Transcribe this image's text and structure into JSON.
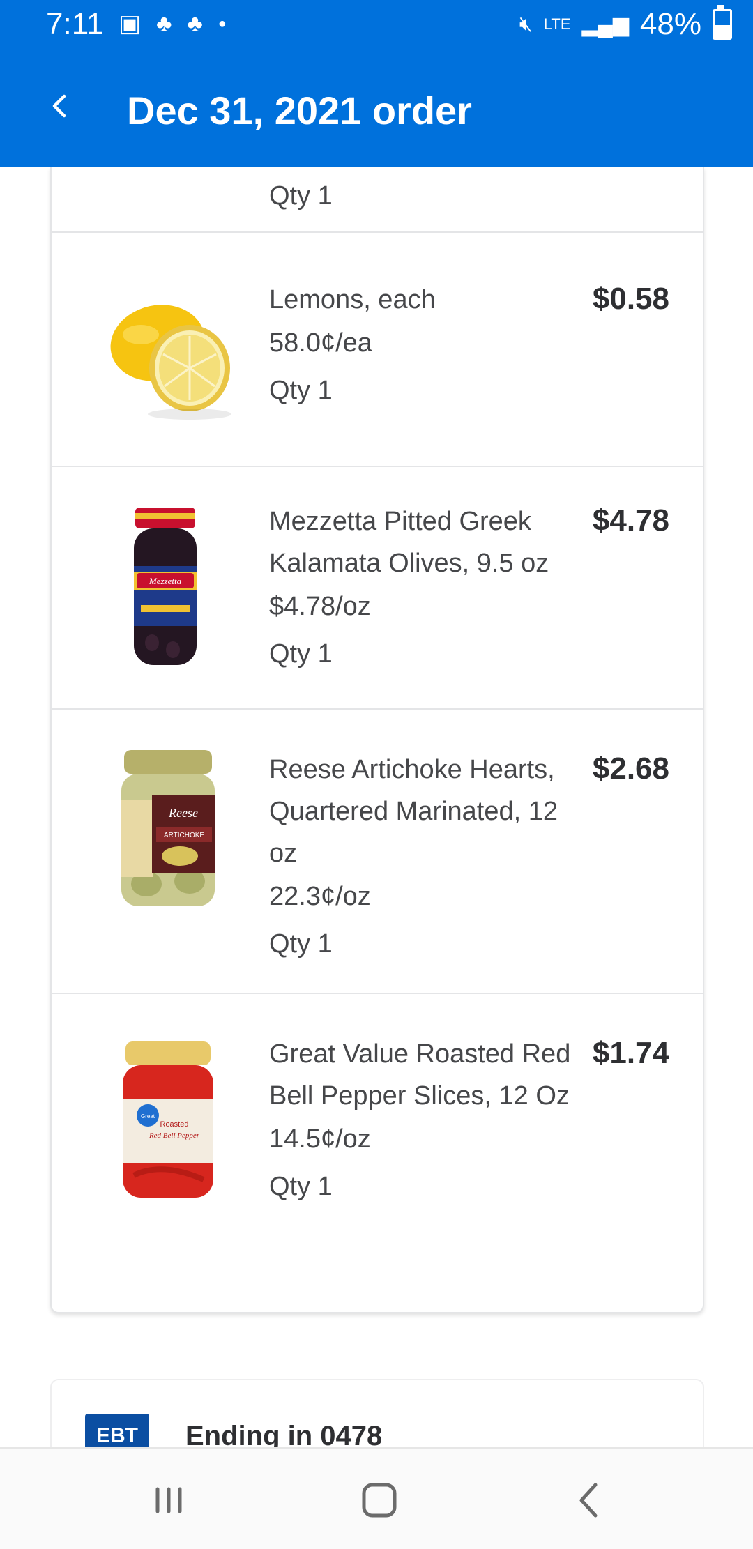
{
  "status_bar": {
    "time": "7:11",
    "battery_percent": "48%",
    "network": "LTE",
    "battery_level": 0.48,
    "icons": [
      "image-icon",
      "plant-icon",
      "plant-icon",
      "dot-icon",
      "mute-icon",
      "lte-icon",
      "signal-icon",
      "battery-icon"
    ]
  },
  "header": {
    "title": "Dec 31, 2021 order",
    "back_icon": "chevron-left-icon"
  },
  "partial_item": {
    "qty": "Qty 1"
  },
  "items": [
    {
      "name": "Lemons, each",
      "unit_price": "58.0¢/ea",
      "qty": "Qty 1",
      "price": "$0.58",
      "image": "lemon"
    },
    {
      "name": "Mezzetta Pitted Greek Kalamata Olives, 9.5 oz",
      "unit_price": "$4.78/oz",
      "qty": "Qty 1",
      "price": "$4.78",
      "image": "olive-jar"
    },
    {
      "name": "Reese Artichoke Hearts, Quartered Marinated, 12 oz",
      "unit_price": "22.3¢/oz",
      "qty": "Qty 1",
      "price": "$2.68",
      "image": "artichoke-jar"
    },
    {
      "name": "Great Value Roasted Red Bell Pepper Slices, 12 Oz",
      "unit_price": "14.5¢/oz",
      "qty": "Qty 1",
      "price": "$1.74",
      "image": "pepper-jar"
    }
  ],
  "payment": {
    "logo_text": "EBT",
    "ending": "Ending in 0478"
  },
  "colors": {
    "brand_blue": "#0071dc",
    "divider": "#e4e5e7",
    "text": "#46474a"
  },
  "nav_bar": {
    "icons": [
      "recent-apps-icon",
      "home-icon",
      "back-icon"
    ]
  }
}
